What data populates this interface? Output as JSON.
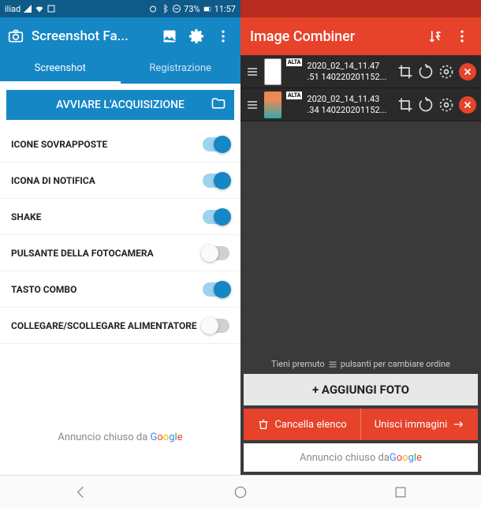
{
  "left": {
    "status": {
      "carrier": "iliad",
      "battery": "73%",
      "time": "11:57"
    },
    "header": {
      "title": "Screenshot Fa..."
    },
    "tabs": {
      "active": "Screenshot",
      "inactive": "Registrazione"
    },
    "acquire": {
      "label": "AVVIARE L'ACQUISIZIONE"
    },
    "settings": [
      {
        "label": "ICONE SOVRAPPOSTE",
        "on": true
      },
      {
        "label": "ICONA DI NOTIFICA",
        "on": true
      },
      {
        "label": "SHAKE",
        "on": true
      },
      {
        "label": "PULSANTE DELLA FOTOCAMERA",
        "on": false
      },
      {
        "label": "TASTO COMBO",
        "on": true
      },
      {
        "label": "COLLEGARE/SCOLLEGARE ALIMENTATORE",
        "on": false
      }
    ],
    "ad": {
      "prefix": "Annuncio chiuso da "
    }
  },
  "right": {
    "header": {
      "title": "Image Combiner"
    },
    "images": [
      {
        "badge": "ALTA",
        "name": "2020_02_14_11.47",
        "sub": ".51 140220201152..."
      },
      {
        "badge": "ALTA",
        "name": "2020_02_14_11.43",
        "sub": ".34 140220201152..."
      }
    ],
    "hint_pre": "Tieni premuto",
    "hint_post": "pulsanti per cambiare ordine",
    "add_photo": "+ AGGIUNGI FOTO",
    "clear_list": "Cancella elenco",
    "merge": "Unisci immagini",
    "ad": {
      "prefix": "Annuncio chiuso da "
    }
  }
}
